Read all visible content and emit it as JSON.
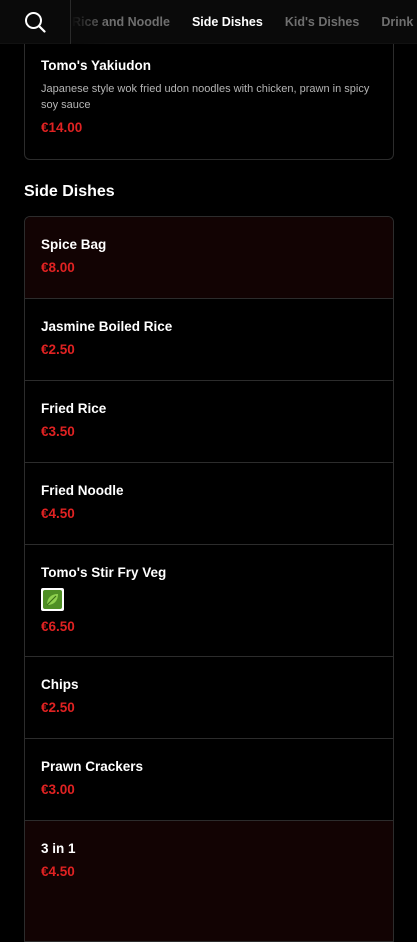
{
  "nav": {
    "search_icon": "search-icon",
    "tabs": [
      {
        "label": "Rice and Noodle",
        "active": false
      },
      {
        "label": "Side Dishes",
        "active": true
      },
      {
        "label": "Kid's Dishes",
        "active": false
      },
      {
        "label": "Drink",
        "active": false
      }
    ]
  },
  "previous_item": {
    "name": "Tomo's Yakiudon",
    "description": "Japanese style wok fried udon noodles with chicken, prawn in spicy soy sauce",
    "price": "€14.00"
  },
  "section": {
    "title": "Side Dishes",
    "items": [
      {
        "name": "Spice Bag",
        "price": "€8.00"
      },
      {
        "name": "Jasmine Boiled Rice",
        "price": "€2.50"
      },
      {
        "name": "Fried Rice",
        "price": "€3.50"
      },
      {
        "name": "Fried Noodle",
        "price": "€4.50"
      },
      {
        "name": "Tomo's Stir Fry Veg",
        "price": "€6.50",
        "badge": "leaf-icon"
      },
      {
        "name": "Chips",
        "price": "€2.50"
      },
      {
        "name": "Prawn Crackers",
        "price": "€3.00"
      },
      {
        "name": "3 in 1",
        "price": "€4.50"
      }
    ]
  },
  "colors": {
    "background": "#000000",
    "price": "#e02222",
    "tinted_row": "#120303",
    "leaf": "#5aa02c"
  }
}
